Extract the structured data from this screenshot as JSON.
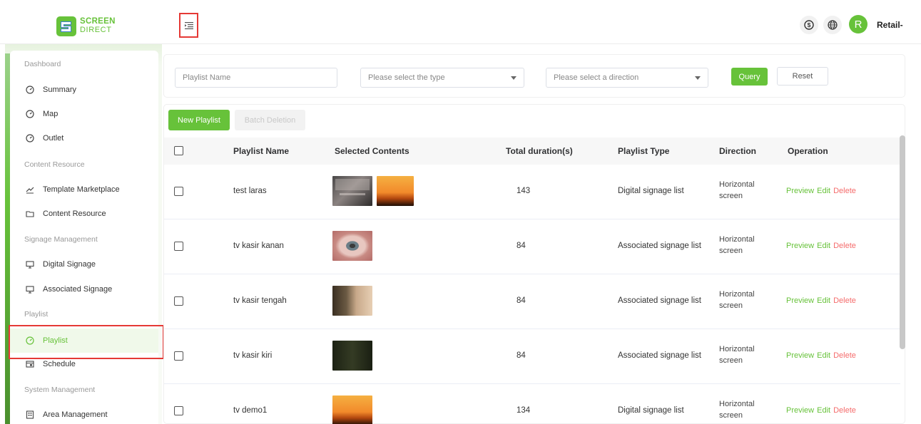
{
  "logo": {
    "line1": "SCREEN",
    "line2": "DIRECT"
  },
  "header": {
    "user_initial": "R",
    "user_name": "Retail-",
    "icons": [
      "dollar-icon",
      "globe-icon"
    ]
  },
  "sidebar": {
    "sections": {
      "dashboard": "Dashboard",
      "content": "Content Resource",
      "signage": "Signage Management",
      "playlist": "Playlist",
      "system": "System Management"
    },
    "items": {
      "summary": "Summary",
      "map": "Map",
      "outlet": "Outlet",
      "template": "Template Marketplace",
      "content_resource": "Content Resource",
      "digital_signage": "Digital Signage",
      "associated_signage": "Associated Signage",
      "playlist": "Playlist",
      "schedule": "Schedule",
      "area": "Area Management"
    },
    "active": "playlist"
  },
  "filters": {
    "name_placeholder": "Playlist Name",
    "type_placeholder": "Please select the type",
    "direction_placeholder": "Please select a direction",
    "query_label": "Query",
    "reset_label": "Reset"
  },
  "toolbar": {
    "new_label": "New Playlist",
    "batch_label": "Batch Deletion"
  },
  "table": {
    "columns": [
      "Playlist Name",
      "Selected Contents",
      "Total duration(s)",
      "Playlist Type",
      "Direction",
      "Operation"
    ],
    "rows": [
      {
        "name": "test laras",
        "duration": "143",
        "type": "Digital signage list",
        "dir1": "Horizontal",
        "dir2": "screen",
        "thumbs": [
          "dark-photo",
          "sunset"
        ]
      },
      {
        "name": "tv kasir kanan",
        "duration": "84",
        "type": "Associated signage list",
        "dir1": "Horizontal",
        "dir2": "screen",
        "thumbs": [
          "eye"
        ]
      },
      {
        "name": "tv kasir tengah",
        "duration": "84",
        "type": "Associated signage list",
        "dir1": "Horizontal",
        "dir2": "screen",
        "thumbs": [
          "skin"
        ]
      },
      {
        "name": "tv kasir kiri",
        "duration": "84",
        "type": "Associated signage list",
        "dir1": "Horizontal",
        "dir2": "screen",
        "thumbs": [
          "dark-green"
        ]
      },
      {
        "name": "tv demo1",
        "duration": "134",
        "type": "Digital signage list",
        "dir1": "Horizontal",
        "dir2": "screen",
        "thumbs": [
          "sunset"
        ]
      }
    ],
    "ops": {
      "preview": "Preview",
      "edit": "Edit",
      "delete": "Delete"
    }
  },
  "colors": {
    "accent": "#67c23a",
    "danger": "#f56c6c",
    "highlight_frame": "#e53935"
  }
}
